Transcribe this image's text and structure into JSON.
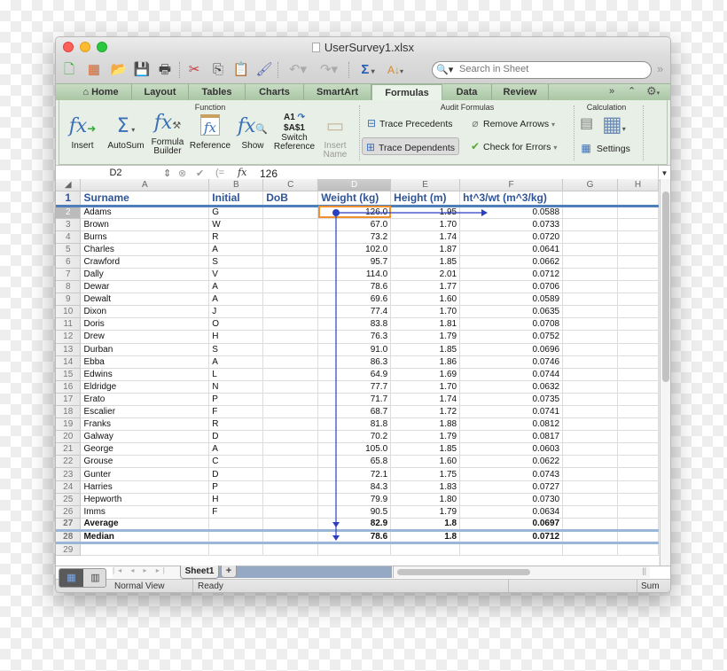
{
  "window": {
    "title": "UserSurvey1.xlsx"
  },
  "toolbar": {
    "icons": [
      "new-workbook",
      "templates",
      "open",
      "save",
      "print",
      "cut",
      "copy",
      "paste",
      "format-painter",
      "undo",
      "redo",
      "autosum",
      "sort"
    ],
    "search_placeholder": "Search in Sheet",
    "overflow": "»"
  },
  "ribbon_tabs": [
    {
      "label": "Home",
      "active": false
    },
    {
      "label": "Layout",
      "active": false
    },
    {
      "label": "Tables",
      "active": false
    },
    {
      "label": "Charts",
      "active": false
    },
    {
      "label": "SmartArt",
      "active": false
    },
    {
      "label": "Formulas",
      "active": true
    },
    {
      "label": "Data",
      "active": false
    },
    {
      "label": "Review",
      "active": false
    }
  ],
  "ribbon": {
    "groups": {
      "function": "Function",
      "audit": "Audit Formulas",
      "calculation": "Calculation"
    },
    "function_buttons": {
      "insert": "Insert",
      "autosum": "AutoSum",
      "formula_builder_1": "Formula",
      "formula_builder_2": "Builder",
      "reference": "Reference",
      "show": "Show",
      "switch_ref_top": "A1",
      "switch_ref_mid": "$A$1",
      "switch_ref_1": "Switch",
      "switch_ref_2": "Reference",
      "insert_name_1": "Insert",
      "insert_name_2": "Name"
    },
    "audit_buttons": {
      "trace_precedents": "Trace Precedents",
      "trace_dependents": "Trace Dependents",
      "remove_arrows": "Remove Arrows",
      "check_errors": "Check for Errors"
    },
    "calc_buttons": {
      "settings": "Settings"
    }
  },
  "formula_bar": {
    "name_box": "D2",
    "fx": "fx",
    "value": "126"
  },
  "columns": [
    "A",
    "B",
    "C",
    "D",
    "E",
    "F",
    "G",
    "H"
  ],
  "selected_cell": "D2",
  "header_row": [
    "Surname",
    "Initial",
    "DoB",
    "Weight (kg)",
    "Height (m)",
    "ht^3/wt (m^3/kg)",
    "",
    ""
  ],
  "rows": [
    [
      "Adams",
      "G",
      "",
      "126.0",
      "1.95",
      "0.0588"
    ],
    [
      "Brown",
      "W",
      "",
      "67.0",
      "1.70",
      "0.0733"
    ],
    [
      "Burns",
      "R",
      "",
      "73.2",
      "1.74",
      "0.0720"
    ],
    [
      "Charles",
      "A",
      "",
      "102.0",
      "1.87",
      "0.0641"
    ],
    [
      "Crawford",
      "S",
      "",
      "95.7",
      "1.85",
      "0.0662"
    ],
    [
      "Dally",
      "V",
      "",
      "114.0",
      "2.01",
      "0.0712"
    ],
    [
      "Dewar",
      "A",
      "",
      "78.6",
      "1.77",
      "0.0706"
    ],
    [
      "Dewalt",
      "A",
      "",
      "69.6",
      "1.60",
      "0.0589"
    ],
    [
      "Dixon",
      "J",
      "",
      "77.4",
      "1.70",
      "0.0635"
    ],
    [
      "Doris",
      "O",
      "",
      "83.8",
      "1.81",
      "0.0708"
    ],
    [
      "Drew",
      "H",
      "",
      "76.3",
      "1.79",
      "0.0752"
    ],
    [
      "Durban",
      "S",
      "",
      "91.0",
      "1.85",
      "0.0696"
    ],
    [
      "Ebba",
      "A",
      "",
      "86.3",
      "1.86",
      "0.0746"
    ],
    [
      "Edwins",
      "L",
      "",
      "64.9",
      "1.69",
      "0.0744"
    ],
    [
      "Eldridge",
      "N",
      "",
      "77.7",
      "1.70",
      "0.0632"
    ],
    [
      "Erato",
      "P",
      "",
      "71.7",
      "1.74",
      "0.0735"
    ],
    [
      "Escalier",
      "F",
      "",
      "68.7",
      "1.72",
      "0.0741"
    ],
    [
      "Franks",
      "R",
      "",
      "81.8",
      "1.88",
      "0.0812"
    ],
    [
      "Galway",
      "D",
      "",
      "70.2",
      "1.79",
      "0.0817"
    ],
    [
      "George",
      "A",
      "",
      "105.0",
      "1.85",
      "0.0603"
    ],
    [
      "Grouse",
      "C",
      "",
      "65.8",
      "1.60",
      "0.0622"
    ],
    [
      "Gunter",
      "D",
      "",
      "72.1",
      "1.75",
      "0.0743"
    ],
    [
      "Harries",
      "P",
      "",
      "84.3",
      "1.83",
      "0.0727"
    ],
    [
      "Hepworth",
      "H",
      "",
      "79.9",
      "1.80",
      "0.0730"
    ],
    [
      "Imms",
      "F",
      "",
      "90.5",
      "1.79",
      "0.0634"
    ]
  ],
  "summary_rows": [
    [
      "Average",
      "",
      "",
      "82.9",
      "1.8",
      "0.0697"
    ],
    [
      "Median",
      "",
      "",
      "78.6",
      "1.8",
      "0.0712"
    ]
  ],
  "sheet_tabs": [
    {
      "label": "Sheet1",
      "active": true
    }
  ],
  "add_sheet": "+",
  "status": {
    "view": "Normal View",
    "state": "Ready",
    "sum": "Sum"
  }
}
